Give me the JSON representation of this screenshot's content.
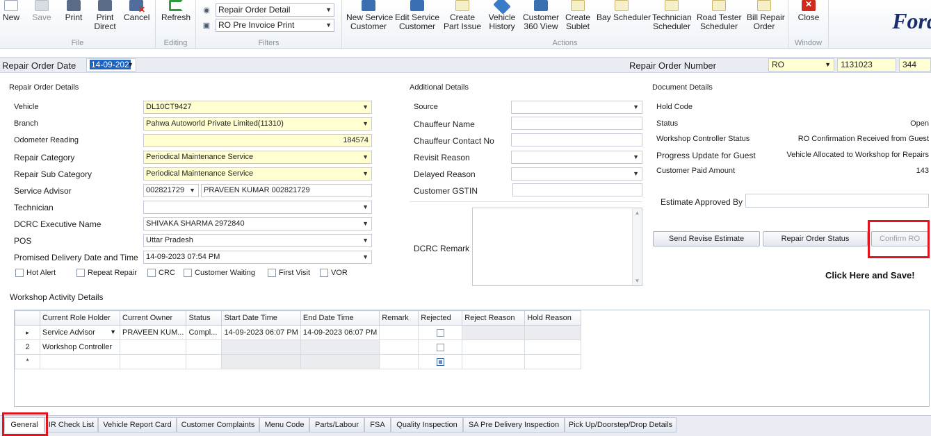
{
  "ribbon": {
    "file": {
      "title": "File",
      "new": "New",
      "save": "Save",
      "print": "Print",
      "print_direct": [
        "Print",
        "Direct"
      ],
      "cancel": "Cancel"
    },
    "editing": {
      "title": "Editing",
      "refresh": "Refresh"
    },
    "filters": {
      "title": "Filters",
      "view_value": "Repair Order Detail",
      "print_value": "RO Pre Invoice Print"
    },
    "actions": {
      "title": "Actions",
      "buttons": [
        {
          "l1": "New Service",
          "l2": "Customer"
        },
        {
          "l1": "Edit Service",
          "l2": "Customer"
        },
        {
          "l1": "Create",
          "l2": "Part Issue"
        },
        {
          "l1": "Vehicle",
          "l2": "History"
        },
        {
          "l1": "Customer",
          "l2": "360 View"
        },
        {
          "l1": "Create",
          "l2": "Sublet"
        },
        {
          "l1": "Bay Scheduler",
          "l2": ""
        },
        {
          "l1": "Technician",
          "l2": "Scheduler"
        },
        {
          "l1": "Road Tester",
          "l2": "Scheduler"
        },
        {
          "l1": "Bill Repair",
          "l2": "Order"
        }
      ]
    },
    "window": {
      "title": "Window",
      "close": "Close"
    },
    "logo": "Ford"
  },
  "header": {
    "ro_date_label": "Repair Order Date",
    "ro_date_value": "14-09-202",
    "ro_number_label": "Repair Order Number",
    "ro_prefix": "RO",
    "ro_number": "1131023",
    "ro_suffix": "344"
  },
  "repair_order": {
    "title": "Repair Order Details",
    "vehicle_label": "Vehicle",
    "vehicle": "DL10CT9427",
    "branch_label": "Branch",
    "branch": "Pahwa Autoworld Private Limited(11310)",
    "odometer_label": "Odometer Reading",
    "odometer": "184574",
    "category_label": "Repair Category",
    "category": "Periodical Maintenance Service",
    "subcategory_label": "Repair Sub Category",
    "subcategory": "Periodical Maintenance Service",
    "advisor_label": "Service Advisor",
    "advisor_code": "002821729",
    "advisor_name": "PRAVEEN   KUMAR   002821729",
    "technician_label": "Technician",
    "technician": "",
    "dcrc_label": "DCRC Executive Name",
    "dcrc": "SHIVAKA   SHARMA 2972840",
    "pos_label": "POS",
    "pos": "Uttar Pradesh",
    "promised_label": "Promised Delivery Date and Time",
    "promised": "14-09-2023 07:54 PM",
    "checks": [
      "Hot Alert",
      "Repeat Repair",
      "CRC",
      "Customer Waiting",
      "First Visit",
      "VOR"
    ]
  },
  "additional": {
    "title": "Additional Details",
    "source_label": "Source",
    "chauffeur_name_label": "Chauffeur Name",
    "chauffeur_contact_label": "Chauffeur Contact No",
    "revisit_label": "Revisit Reason",
    "delayed_label": "Delayed Reason",
    "gstin_label": "Customer GSTIN",
    "dcrc_remark_label": "DCRC Remark"
  },
  "document": {
    "title": "Document Details",
    "rows": [
      {
        "label": "Hold Code",
        "value": ""
      },
      {
        "label": "Status",
        "value": "Open"
      },
      {
        "label": "Workshop Controller Status",
        "value": "RO Confirmation Received from Guest"
      },
      {
        "label": "Progress Update for Guest",
        "value": "Vehicle Allocated to Workshop for Repairs"
      },
      {
        "label": "Customer Paid Amount",
        "value": "143"
      }
    ],
    "estimate_label": "Estimate Approved By",
    "send_revise": "Send Revise Estimate",
    "ro_status": "Repair Order Status",
    "confirm_ro": "Confirm RO",
    "callout": "Click Here and Save!"
  },
  "workshop": {
    "title": "Workshop Activity Details",
    "columns": [
      "Current Role Holder",
      "Current Owner",
      "Status",
      "Start Date Time",
      "End Date Time",
      "Remark",
      "Rejected",
      "Reject Reason",
      "Hold Reason"
    ],
    "rows": [
      {
        "ind": "▸",
        "role": "Service Advisor",
        "owner": "PRAVEEN   KUM...",
        "status": "Compl...",
        "start": "14-09-2023 06:07 PM",
        "end": "14-09-2023 06:07 PM"
      },
      {
        "ind": "2",
        "role": "Workshop Controller",
        "owner": "",
        "status": "",
        "start": "",
        "end": ""
      },
      {
        "ind": "*",
        "role": "",
        "owner": "",
        "status": "",
        "start": "",
        "end": ""
      }
    ]
  },
  "tabs": [
    "General",
    "IR Check List",
    "Vehicle Report Card",
    "Customer Complaints",
    "Menu Code",
    "Parts/Labour",
    "FSA",
    "Quality Inspection",
    "SA Pre Delivery Inspection",
    "Pick Up/Doorstep/Drop Details"
  ],
  "colors": {
    "highlight_red": "#e0141c",
    "input_yellow": "#ffffd2",
    "selection_blue": "#1c63c4"
  }
}
